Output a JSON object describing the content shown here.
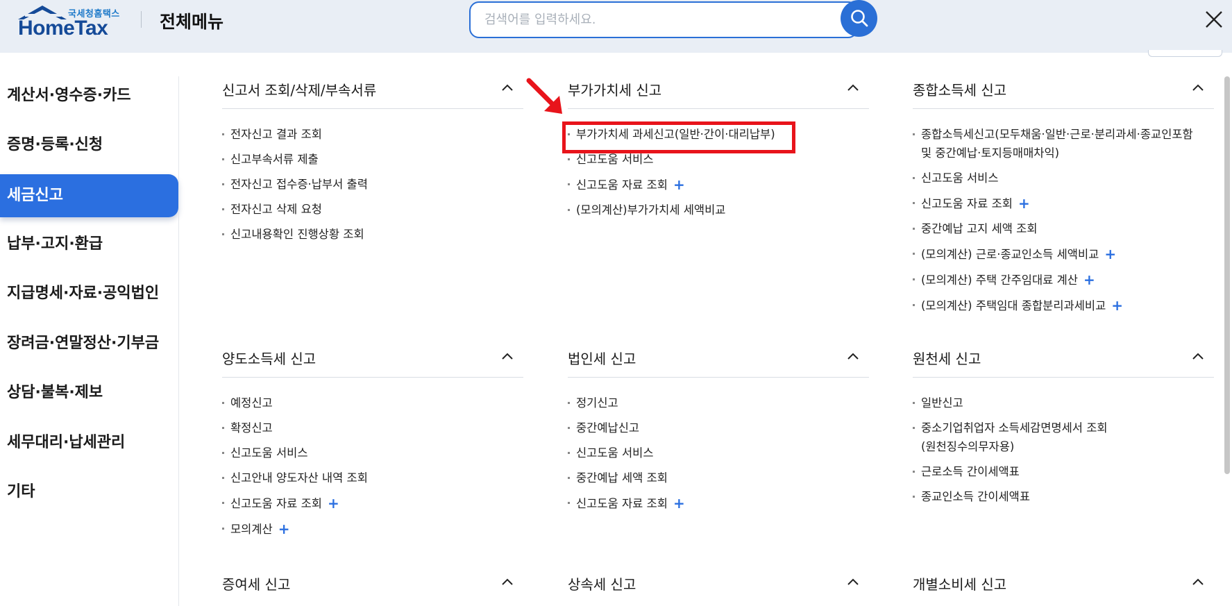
{
  "header": {
    "logo_sub": "국세청홈택스",
    "logo_main": "HomeTax",
    "title": "전체메뉴",
    "search_placeholder": "검색어를 입력하세요.",
    "search_icon": "search-icon",
    "close_icon": "close-icon"
  },
  "sidebar": {
    "items": [
      {
        "label": "계산서·영수증·카드"
      },
      {
        "label": "증명·등록·신청"
      },
      {
        "label": "세금신고"
      },
      {
        "label": "납부·고지·환급"
      },
      {
        "label": "지급명세·자료·공익법인"
      },
      {
        "label": "장려금·연말정산·기부금"
      },
      {
        "label": "상담·불복·제보"
      },
      {
        "label": "세무대리·납세관리"
      },
      {
        "label": "기타"
      }
    ],
    "active_index": 2
  },
  "colors": {
    "accent": "#2b6fe0",
    "highlight": "#e8141b",
    "header_bg": "#e9eef5"
  },
  "sections": [
    {
      "title": "신고서 조회/삭제/부속서류",
      "items": [
        {
          "label": "전자신고 결과 조회"
        },
        {
          "label": "신고부속서류 제출"
        },
        {
          "label": "전자신고 접수증·납부서 출력"
        },
        {
          "label": "전자신고 삭제 요청"
        },
        {
          "label": "신고내용확인 진행상황 조회"
        }
      ]
    },
    {
      "title": "부가가치세 신고",
      "items": [
        {
          "label": "부가가치세 과세신고(일반·간이·대리납부)"
        },
        {
          "label": "신고도움 서비스"
        },
        {
          "label": "신고도움 자료 조회",
          "plus": "+"
        },
        {
          "label": "(모의계산)부가가치세 세액비교"
        }
      ]
    },
    {
      "title": "종합소득세 신고",
      "items": [
        {
          "label": "종합소득세신고(모두채움·일반·근로·분리과세·종교인포함",
          "label2": "및 중간예납·토지등매매차익)"
        },
        {
          "label": "신고도움 서비스"
        },
        {
          "label": "신고도움 자료 조회",
          "plus": "+"
        },
        {
          "label": "중간예납 고지 세액 조회"
        },
        {
          "label": "(모의계산) 근로·종교인소득 세액비교",
          "plus": "+"
        },
        {
          "label": "(모의계산) 주택 간주임대료 계산",
          "plus": "+"
        },
        {
          "label": "(모의계산) 주택임대 종합분리과세비교",
          "plus": "+"
        }
      ]
    },
    {
      "title": "양도소득세 신고",
      "items": [
        {
          "label": "예정신고"
        },
        {
          "label": "확정신고"
        },
        {
          "label": "신고도움 서비스"
        },
        {
          "label": "신고안내 양도자산 내역 조회"
        },
        {
          "label": "신고도움 자료 조회",
          "plus": "+"
        },
        {
          "label": "모의계산",
          "plus": "+"
        }
      ]
    },
    {
      "title": "법인세 신고",
      "items": [
        {
          "label": "정기신고"
        },
        {
          "label": "중간예납신고"
        },
        {
          "label": "신고도움 서비스"
        },
        {
          "label": "중간예납 세액 조회"
        },
        {
          "label": "신고도움 자료 조회",
          "plus": "+"
        }
      ]
    },
    {
      "title": "원천세 신고",
      "items": [
        {
          "label": "일반신고"
        },
        {
          "label": "중소기업취업자 소득세감면명세서 조회",
          "label2": "(원천징수의무자용)"
        },
        {
          "label": "근로소득 간이세액표"
        },
        {
          "label": "종교인소득 간이세액표"
        }
      ]
    },
    {
      "title": "증여세 신고",
      "items": []
    },
    {
      "title": "상속세 신고",
      "items": []
    },
    {
      "title": "개별소비세 신고",
      "items": []
    }
  ]
}
